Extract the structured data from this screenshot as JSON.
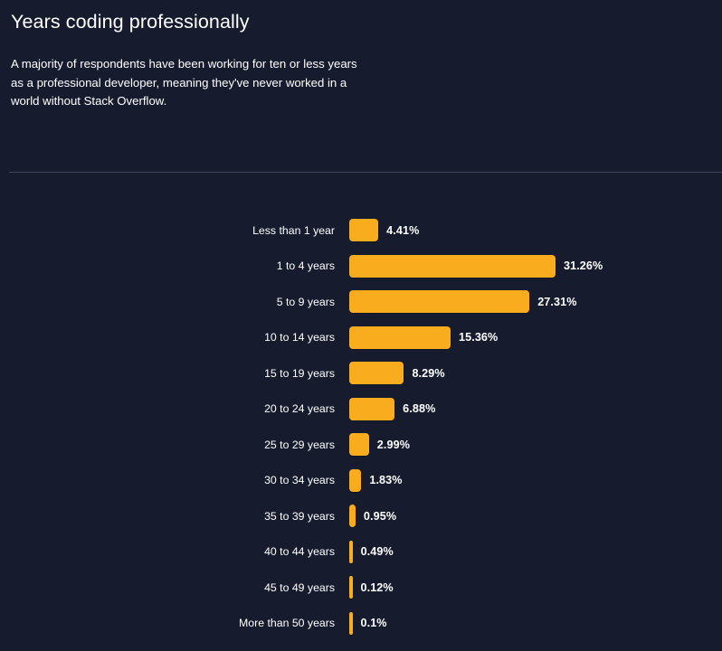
{
  "header": {
    "title": "Years coding professionally",
    "subtitle": "A majority of respondents have been working for ten or less years as a professional developer, meaning they've never worked in a world without Stack Overflow."
  },
  "theme": {
    "background": "#161c2e",
    "bar_color": "#f9ad1e",
    "text_color": "#ffffff",
    "divider_color": "#3d455c"
  },
  "chart_data": {
    "type": "bar",
    "orientation": "horizontal",
    "title": "Years coding professionally",
    "xlabel": "",
    "ylabel": "",
    "grid": false,
    "legend": null,
    "xlim": [
      0,
      31.26
    ],
    "value_suffix": "%",
    "categories": [
      "Less than 1 year",
      "1 to 4 years",
      "5 to 9 years",
      "10 to 14 years",
      "15 to 19 years",
      "20 to 24 years",
      "25 to 29 years",
      "30 to 34 years",
      "35 to 39 years",
      "40 to 44 years",
      "45 to 49 years",
      "More than 50 years"
    ],
    "values": [
      4.41,
      31.26,
      27.31,
      15.36,
      8.29,
      6.88,
      2.99,
      1.83,
      0.95,
      0.49,
      0.12,
      0.1
    ],
    "labels": [
      "4.41%",
      "31.26%",
      "27.31%",
      "15.36%",
      "8.29%",
      "6.88%",
      "2.99%",
      "1.83%",
      "0.95%",
      "0.49%",
      "0.12%",
      "0.1%"
    ]
  }
}
